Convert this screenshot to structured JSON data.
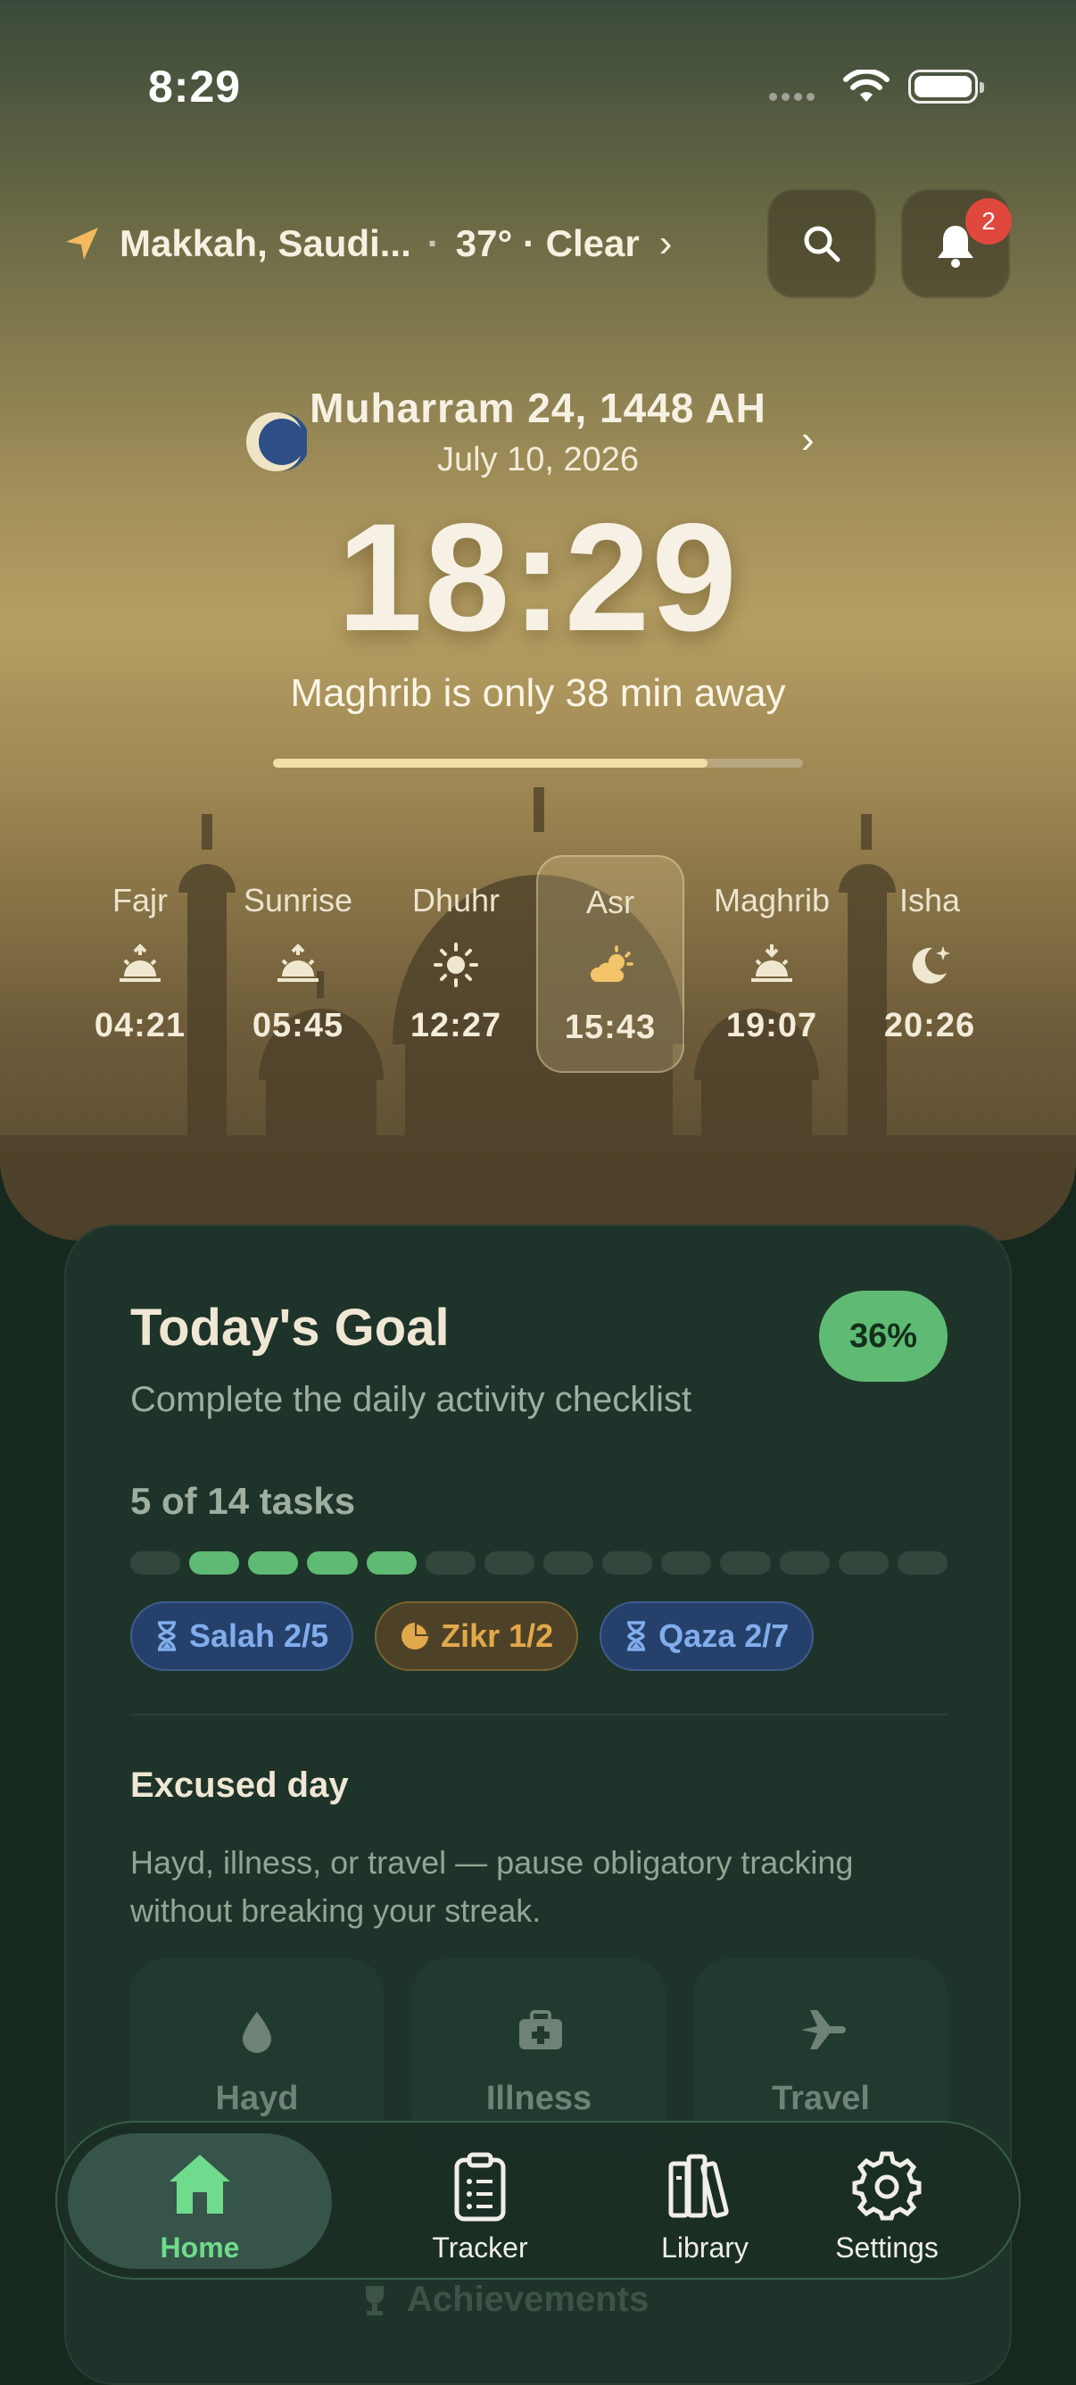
{
  "status_bar": {
    "time": "8:29"
  },
  "header": {
    "location": "Makkah, Saudi...",
    "weather": "37° · Clear",
    "notification_count": "2"
  },
  "date": {
    "hijri": "Muharram 24, 1448 AH",
    "gregorian": "July 10, 2026"
  },
  "clock": {
    "time": "18:29",
    "next_prayer_text": "Maghrib is only 38 min away",
    "progress": 0.82
  },
  "prayers": [
    {
      "name": "Fajr",
      "time": "04:21",
      "icon": "sunrise-icon"
    },
    {
      "name": "Sunrise",
      "time": "05:45",
      "icon": "sunrise-icon"
    },
    {
      "name": "Dhuhr",
      "time": "12:27",
      "icon": "sun-icon"
    },
    {
      "name": "Asr",
      "time": "15:43",
      "icon": "partly-cloudy-icon",
      "active": true
    },
    {
      "name": "Maghrib",
      "time": "19:07",
      "icon": "sunset-icon"
    },
    {
      "name": "Isha",
      "time": "20:26",
      "icon": "moon-stars-icon"
    }
  ],
  "goal": {
    "title": "Today's Goal",
    "subtitle": "Complete the daily activity checklist",
    "percent": "36%",
    "tasks_text": "5 of 14 tasks",
    "segments_total": 14,
    "segments_done_pattern": [
      0,
      1,
      1,
      1,
      1,
      0,
      0,
      0,
      0,
      0,
      0,
      0,
      0,
      0
    ],
    "chips": [
      {
        "label": "Salah 2/5",
        "color": "blue",
        "icon": "hourglass-icon"
      },
      {
        "label": "Zikr 1/2",
        "color": "gold",
        "icon": "pie-icon"
      },
      {
        "label": "Qaza 2/7",
        "color": "blue",
        "icon": "hourglass-icon"
      }
    ]
  },
  "excused": {
    "title": "Excused day",
    "description": "Hayd, illness, or travel — pause obligatory tracking without breaking your streak.",
    "options": [
      {
        "label": "Hayd",
        "icon": "drop-icon"
      },
      {
        "label": "Illness",
        "icon": "medkit-icon"
      },
      {
        "label": "Travel",
        "icon": "plane-icon"
      }
    ]
  },
  "achievements_label": "Achievements",
  "tabbar": {
    "items": [
      {
        "label": "Home",
        "icon": "home-icon",
        "active": true
      },
      {
        "label": "Tracker",
        "icon": "clipboard-icon"
      },
      {
        "label": "Library",
        "icon": "library-icon"
      },
      {
        "label": "Settings",
        "icon": "gear-icon"
      }
    ]
  },
  "colors": {
    "accent_green": "#5fbb73",
    "badge_red": "#e0483e",
    "chip_blue": "#82adec",
    "chip_gold": "#e2a94a"
  }
}
